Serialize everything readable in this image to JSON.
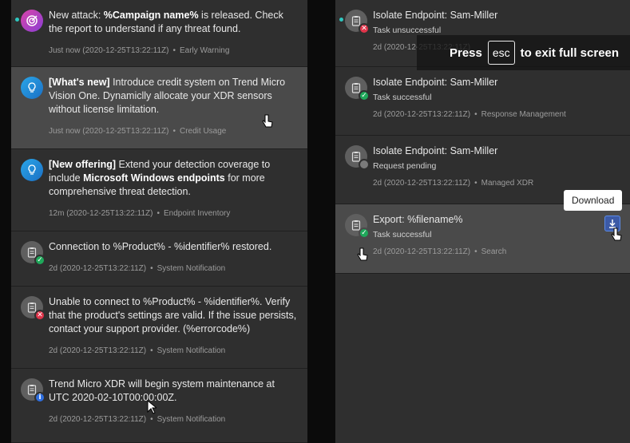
{
  "left_notifications": [
    {
      "title_parts": [
        "New attack: ",
        "%Campaign name%",
        " is released. Check the report to understand if any threat found."
      ],
      "time": "Just now (2020-12-25T13:22:11Z)",
      "category": "Early Warning",
      "icon": "target-icon",
      "status": null
    },
    {
      "title_parts": [
        "[What's new]",
        " Introduce credit system on Trend Micro Vision One.  Dynamiclly allocate your XDR sensors without license limitation."
      ],
      "time": "Just now (2020-12-25T13:22:11Z)",
      "category": "Credit Usage",
      "icon": "lightbulb-icon",
      "status": null
    },
    {
      "title_parts": [
        "[New offering]",
        " Extend your detection coverage to include ",
        "Microsoft Windows endpoints",
        " for more comprehensive threat detection."
      ],
      "time": "12m (2020-12-25T13:22:11Z)",
      "category": "Endpoint Inventory",
      "icon": "lightbulb-icon",
      "status": null
    },
    {
      "title": "Connection to %Product% - %identifier% restored.",
      "time": "2d (2020-12-25T13:22:11Z)",
      "category": "System Notification",
      "icon": "clipboard-icon",
      "status": "success"
    },
    {
      "title": "Unable to connect to %Product% - %identifier%. Verify that the product's settings are valid. If the issue persists, contact your support provider. (%errorcode%)",
      "time": "2d (2020-12-25T13:22:11Z)",
      "category": "System Notification",
      "icon": "clipboard-icon",
      "status": "error"
    },
    {
      "title": "Trend Micro XDR will begin system maintenance at UTC 2020-02-10T00:00:00Z.",
      "time": "2d (2020-12-25T13:22:11Z)",
      "category": "System Notification",
      "icon": "clipboard-icon",
      "status": "info"
    }
  ],
  "right_notifications": [
    {
      "title": "Isolate Endpoint: Sam-Miller",
      "subtitle": "Task unsuccessful",
      "time": "2d (2020-12-25T13:22:11Z)",
      "category": "",
      "status": "error"
    },
    {
      "title": "Isolate Endpoint: Sam-Miller",
      "subtitle": "Task successful",
      "time": "2d (2020-12-25T13:22:11Z)",
      "category": "Response Management",
      "status": "success"
    },
    {
      "title": "Isolate Endpoint: Sam-Miller",
      "subtitle": "Request pending",
      "time": "2d (2020-12-25T13:22:11Z)",
      "category": "Managed XDR",
      "status": "pending"
    },
    {
      "title": "Export: %filename%",
      "subtitle": "Task successful",
      "time": "2d (2020-12-25T13:22:11Z)",
      "category": "Search",
      "status": "success"
    }
  ],
  "fullscreen_overlay": {
    "press": "Press",
    "key": "esc",
    "rest": "to exit full screen"
  },
  "tooltip": "Download",
  "separator": "•",
  "colors": {
    "accent_teal": "#2ec7c0",
    "success": "#1fa85a",
    "error": "#e0344a",
    "info": "#2f6fe0"
  }
}
